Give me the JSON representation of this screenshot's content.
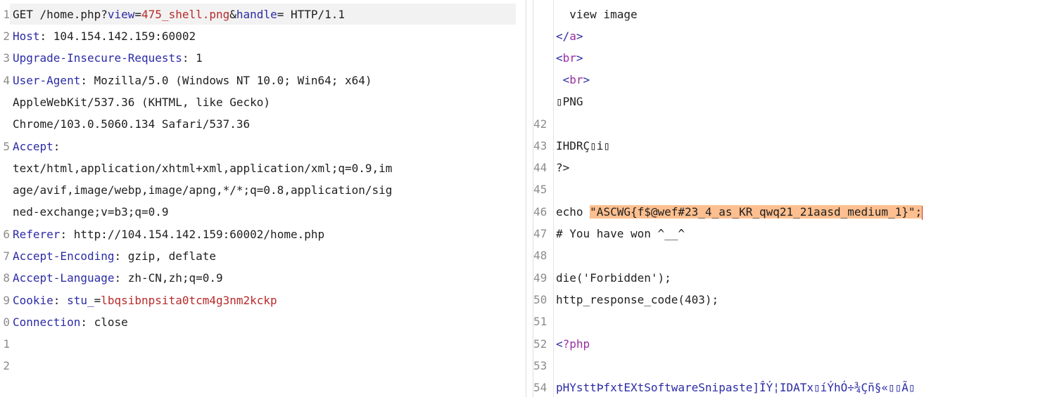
{
  "request": {
    "line1": {
      "num": "1",
      "method": "GET /home.php?",
      "param1_key": "view",
      "eq1": "=",
      "param1_val": "475_shell.png",
      "amp": "&",
      "param2_key": "handle",
      "eq2": "=",
      "tail": " HTTP/1.1"
    },
    "headers": [
      {
        "num": "2",
        "key": "Host",
        "val": ": 104.154.142.159:60002"
      },
      {
        "num": "3",
        "key": "Upgrade-Insecure-Requests",
        "val": ": 1"
      },
      {
        "num": "4",
        "key": "User-Agent",
        "val": ": Mozilla/5.0 (Windows NT 10.0; Win64; x64)"
      },
      {
        "num": "",
        "key": "",
        "val": "AppleWebKit/537.36 (KHTML, like Gecko)"
      },
      {
        "num": "",
        "key": "",
        "val": "Chrome/103.0.5060.134 Safari/537.36"
      },
      {
        "num": "5",
        "key": "Accept",
        "val": ":"
      },
      {
        "num": "",
        "key": "",
        "val": "text/html,application/xhtml+xml,application/xml;q=0.9,im"
      },
      {
        "num": "",
        "key": "",
        "val": "age/avif,image/webp,image/apng,*/*;q=0.8,application/sig"
      },
      {
        "num": "",
        "key": "",
        "val": "ned-exchange;v=b3;q=0.9"
      },
      {
        "num": "6",
        "key": "Referer",
        "val": ": http://104.154.142.159:60002/home.php"
      },
      {
        "num": "7",
        "key": "Accept-Encoding",
        "val": ": gzip, deflate"
      },
      {
        "num": "8",
        "key": "Accept-Language",
        "val": ": zh-CN,zh;q=0.9"
      }
    ],
    "cookie": {
      "num": "9",
      "key": "Cookie",
      "sep": ": ",
      "name": "stu_",
      "eq": "=",
      "value": "lbqsibnpsita0tcm4g3nm2kckp"
    },
    "connection": {
      "num": "0",
      "key": "Connection",
      "val": ": close"
    },
    "empty_lines": [
      "1",
      "2"
    ]
  },
  "response": {
    "l_view": "  view image",
    "l_a_open": "</",
    "l_a_tag": "a",
    "l_a_close": ">",
    "l_br1_open": "<",
    "l_br1_tag": "br",
    "l_br1_close": ">",
    "l_br2_open": " <",
    "l_br2_tag": "br",
    "l_br2_close": ">",
    "l_png": "▯PNG",
    "n42": "42",
    "n43": "43",
    "l43": "IHDRÇ▯i▯",
    "n44": "44",
    "l44": "?>",
    "n45": "45",
    "n46": "46",
    "l46_pre": "echo ",
    "l46_str": "\"ASCWG{f$@wef#23_4_as_KR_qwq21_21aasd_medium_1}\";",
    "n47": "47",
    "l47": "# You have won ^__^",
    "n48": "48",
    "n49": "49",
    "l49": "die('Forbidden');",
    "n50": "50",
    "l50": "http_response_code(403);",
    "n51": "51",
    "n52": "52",
    "l52_lt": "<",
    "l52_php": "?php",
    "n53": "53",
    "n54": "54",
    "l54": "pHYsttÞfxtEXtSoftwareSnipaste]ÎÝ¦IDATx▯íÝhÓ÷¾Çñ§«▯▯Ã▯"
  },
  "colors": {
    "accent": "#e8702a",
    "header_key": "#2b2ba6",
    "param_value": "#b82a2a",
    "highlight": "#fdbf8f",
    "tag": "#9a2ea0"
  }
}
